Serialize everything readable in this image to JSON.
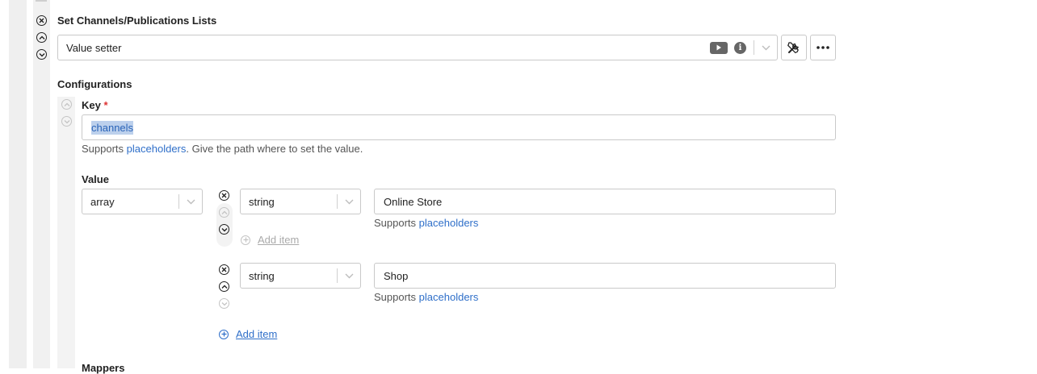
{
  "section": {
    "title": "Set Channels/Publications Lists"
  },
  "step_select": {
    "value": "Value setter"
  },
  "configurations": {
    "title": "Configurations"
  },
  "key": {
    "label": "Key",
    "required_mark": "*",
    "value": "channels",
    "help_prefix": "Supports",
    "help_link": "placeholders",
    "help_suffix": ". Give the path where to set the value."
  },
  "value": {
    "label": "Value",
    "type_select": "array",
    "items": [
      {
        "type": "string",
        "value": "Online Store",
        "help_prefix": "Supports",
        "help_link": "placeholders"
      },
      {
        "type": "string",
        "value": "Shop",
        "help_prefix": "Supports",
        "help_link": "placeholders"
      }
    ],
    "add_item_inline": "Add item",
    "add_item": "Add item"
  },
  "mappers": {
    "label": "Mappers"
  },
  "colors": {
    "accent": "#2f6fc9",
    "required": "#dd3333",
    "selection": "#bcd0ec"
  }
}
